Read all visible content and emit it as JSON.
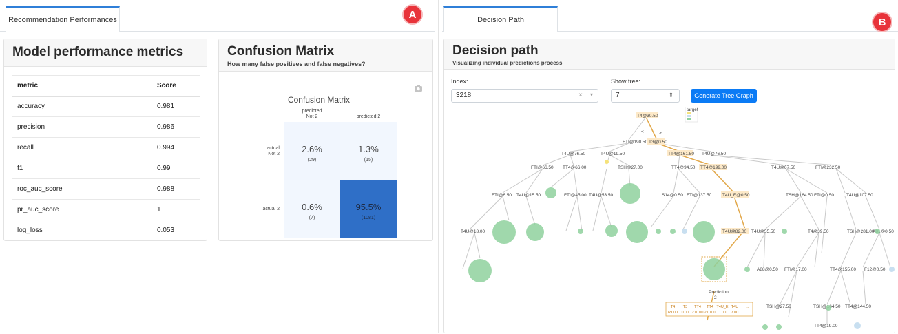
{
  "left_panel": {
    "tab_label": "Recommendation Performances",
    "badge": "A",
    "metrics_card": {
      "title": "Model performance metrics",
      "headers": [
        "metric",
        "Score"
      ],
      "rows": [
        [
          "accuracy",
          "0.981"
        ],
        [
          "precision",
          "0.986"
        ],
        [
          "recall",
          "0.994"
        ],
        [
          "f1",
          "0.99"
        ],
        [
          "roc_auc_score",
          "0.988"
        ],
        [
          "pr_auc_score",
          "1"
        ],
        [
          "log_loss",
          "0.053"
        ]
      ]
    },
    "confusion_card": {
      "title": "Confusion Matrix",
      "subtitle": "How many false positives and false negatives?",
      "camera_icon": "camera-icon"
    }
  },
  "chart_data": {
    "type": "heatmap",
    "title": "Confusion Matrix",
    "x_labels": [
      "predicted\nNot 2",
      "predicted 2"
    ],
    "y_labels": [
      "actual\nNot 2",
      "actual 2"
    ],
    "cells": [
      [
        {
          "pct": "2.6%",
          "count": "(29)",
          "value": 29
        },
        {
          "pct": "1.3%",
          "count": "(15)",
          "value": 15
        }
      ],
      [
        {
          "pct": "0.6%",
          "count": "(7)",
          "value": 7
        },
        {
          "pct": "95.5%",
          "count": "(1081)",
          "value": 1081
        }
      ]
    ],
    "colors": {
      "low": "#f2f7fe",
      "high": "#2f6fc7"
    }
  },
  "right_panel": {
    "tab_label": "Decision Path",
    "badge": "B",
    "card": {
      "title": "Decision path",
      "subtitle": "Visualizing individual predictions process"
    },
    "controls": {
      "index_label": "Index:",
      "index_value": "3218",
      "index_clear": "×",
      "index_caret": "▾",
      "tree_label": "Show tree:",
      "tree_value": "7",
      "tree_caret": "⇕",
      "generate_button": "Generate Tree Graph"
    },
    "tree": {
      "nodes": [
        "T4@30.50",
        "FTI@190.50",
        "T3@0.50",
        "T4U@76.50",
        "T4U@19.50",
        "TT4@161.50",
        "T4U@76.50",
        "FTI@66.50",
        "TT4@66.00",
        "TSH@27.00",
        "TT4@94.50",
        "TT4@199.00",
        "T4U@67.50",
        "FTI@232.50",
        "FTI@6.50",
        "T4U@15.50",
        "FTI@45.00",
        "T4U@53.50",
        "S14@0.50",
        "FTI@137.50",
        "T4U_E@0.50",
        "TSH@164.50",
        "FTI@0.50",
        "T4U@107.50",
        "T4U@18.00",
        "T4U@82.00",
        "T4U@55.50",
        "T4@39.50",
        "TSH@281.00",
        "A81@0.50",
        "A88@0.50",
        "FTI@17.00",
        "TT4@155.00",
        "F12@0.50",
        "TSH@27.50",
        "TSH@164.50",
        "TT4@144.50",
        "TT4@19.00"
      ],
      "edge_left": "<",
      "edge_right": "≥",
      "legend_title": "target",
      "prediction_label": "Prediction",
      "prediction_value": "2",
      "feature_header": [
        "T4",
        "T3",
        "TT4",
        "TT4",
        "T4U_E",
        "T4U",
        "..."
      ],
      "feature_values": [
        "69.00",
        "0.00",
        "210.00",
        "210.00",
        "1.00",
        "7.00",
        "..."
      ]
    }
  }
}
